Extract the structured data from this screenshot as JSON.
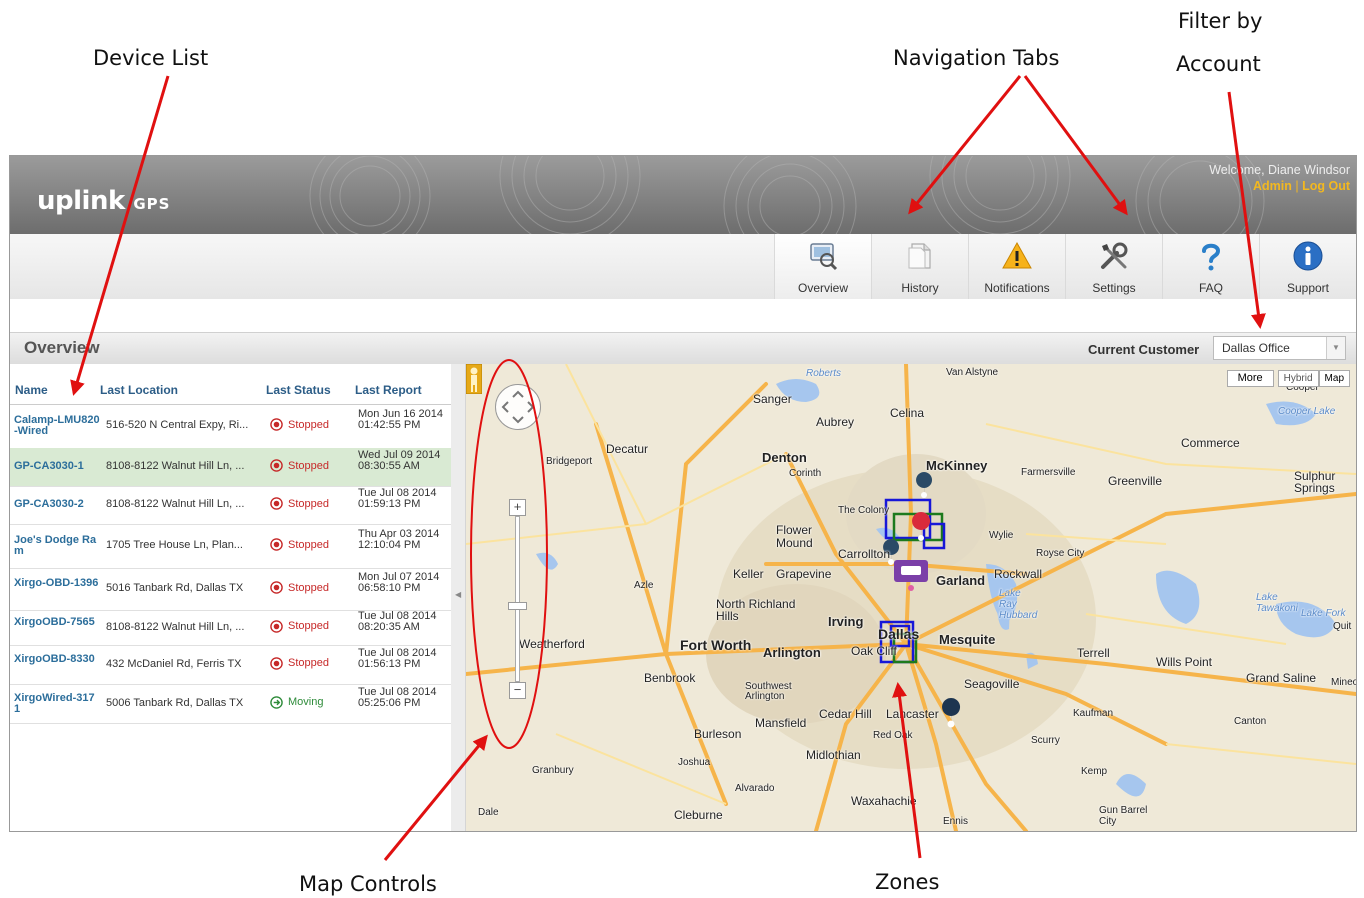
{
  "callouts": {
    "device_list": "Device List",
    "navigation_tabs": "Navigation Tabs",
    "filter_line1": "Filter by",
    "filter_line2": "Account",
    "map_controls": "Map Controls",
    "zones": "Zones"
  },
  "header": {
    "logo_main": "uplink",
    "logo_sub": "GPS",
    "welcome": "Welcome, Diane Windsor",
    "admin_link": "Admin",
    "separator": "|",
    "logout_link": "Log Out"
  },
  "tabs": [
    {
      "label": "Overview",
      "icon": "overview-icon"
    },
    {
      "label": "History",
      "icon": "history-icon"
    },
    {
      "label": "Notifications",
      "icon": "warning-icon"
    },
    {
      "label": "Settings",
      "icon": "tools-icon"
    },
    {
      "label": "FAQ",
      "icon": "question-icon"
    },
    {
      "label": "Support",
      "icon": "info-icon"
    }
  ],
  "overview": {
    "title": "Overview",
    "current_customer_label": "Current Customer",
    "current_customer_value": "Dallas Office"
  },
  "device_list": {
    "columns": [
      "Name",
      "Last Location",
      "Last Status",
      "Last Report"
    ],
    "rows": [
      {
        "name": "Calamp-LMU820-Wired",
        "location": "516-520 N Central Expy, Ri...",
        "status": "Stopped",
        "report": "Mon Jun 16 2014 01:42:55 PM"
      },
      {
        "name": "GP-CA3030-1",
        "location": "8108-8122 Walnut Hill Ln, ...",
        "status": "Stopped",
        "report": "Wed Jul 09 2014 08:30:55 AM"
      },
      {
        "name": "GP-CA3030-2",
        "location": "8108-8122 Walnut Hill Ln, ...",
        "status": "Stopped",
        "report": "Tue Jul 08 2014 01:59:13 PM"
      },
      {
        "name": "Joe's Dodge Ram",
        "location": "1705 Tree House Ln, Plan...",
        "status": "Stopped",
        "report": "Thu Apr 03 2014 12:10:04 PM"
      },
      {
        "name": "Xirgo-OBD-1396",
        "location": "5016 Tanbark Rd, Dallas TX",
        "status": "Stopped",
        "report": "Mon Jul 07 2014 06:58:10 PM"
      },
      {
        "name": "XirgoOBD-7565",
        "location": "8108-8122 Walnut Hill Ln, ...",
        "status": "Stopped",
        "report": "Tue Jul 08 2014 08:20:35 AM"
      },
      {
        "name": "XirgoOBD-8330",
        "location": "432 McDaniel Rd, Ferris TX",
        "status": "Stopped",
        "report": "Tue Jul 08 2014 01:56:13 PM"
      },
      {
        "name": "XirgoWired-3171",
        "location": "5006 Tanbark Rd, Dallas TX",
        "status": "Moving",
        "report": "Tue Jul 08 2014 05:25:06 PM"
      }
    ]
  },
  "map": {
    "more_button": "More",
    "hybrid_button": "Hybrid",
    "map_button": "Map",
    "zoom_in": "+",
    "zoom_out": "−",
    "labels": {
      "sanger": "Sanger",
      "aubrey": "Aubrey",
      "celina": "Celina",
      "van_alstyne": "Van Alstyne",
      "decatur": "Decatur",
      "bridgeport": "Bridgeport",
      "denton": "Denton",
      "corinth": "Corinth",
      "mckinney": "McKinney",
      "farmersville": "Farmersville",
      "commerce": "Commerce",
      "greenville": "Greenville",
      "sulphur_springs": "Sulphur Springs",
      "the_colony": "The Colony",
      "flower_mound": "Flower Mound",
      "carrollton": "Carrollton",
      "wylie": "Wylie",
      "royse_city": "Royse City",
      "keller": "Keller",
      "grapevine": "Grapevine",
      "garland": "Garland",
      "rockwall": "Rockwall",
      "azle": "Azle",
      "north_richland_hills": "North Richland Hills",
      "irving": "Irving",
      "weatherford": "Weatherford",
      "fort_worth": "Fort Worth",
      "arlington": "Arlington",
      "oak_cliff": "Oak Cliff",
      "dallas": "Dallas",
      "mesquite": "Mesquite",
      "terrell": "Terrell",
      "wills_point": "Wills Point",
      "grand_saline": "Grand Saline",
      "benbrook": "Benbrook",
      "southwest_arlington": "Southwest Arlington",
      "mansfield": "Mansfield",
      "cedar_hill": "Cedar Hill",
      "lancaster": "Lancaster",
      "seagoville": "Seagoville",
      "kaufman": "Kaufman",
      "canton": "Canton",
      "burleson": "Burleson",
      "red_oak": "Red Oak",
      "scurry": "Scurry",
      "midlothian": "Midlothian",
      "joshua": "Joshua",
      "granbury": "Granbury",
      "kemp": "Kemp",
      "alvarado": "Alvarado",
      "waxahachie": "Waxahachie",
      "gun_barrel_city": "Gun Barrel City",
      "dale": "Dale",
      "cleburne": "Cleburne",
      "ennis": "Ennis",
      "mineola": "Mineola",
      "quit": "Quit",
      "lake_fork": "Lake Fork",
      "lake_tawakoni": "Lake Tawakoni",
      "lake_ray_hubbard": "Lake Ray Hubbard",
      "roberts": "Roberts",
      "cooper_lake": "Cooper Lake",
      "cooper": "Cooper"
    }
  }
}
